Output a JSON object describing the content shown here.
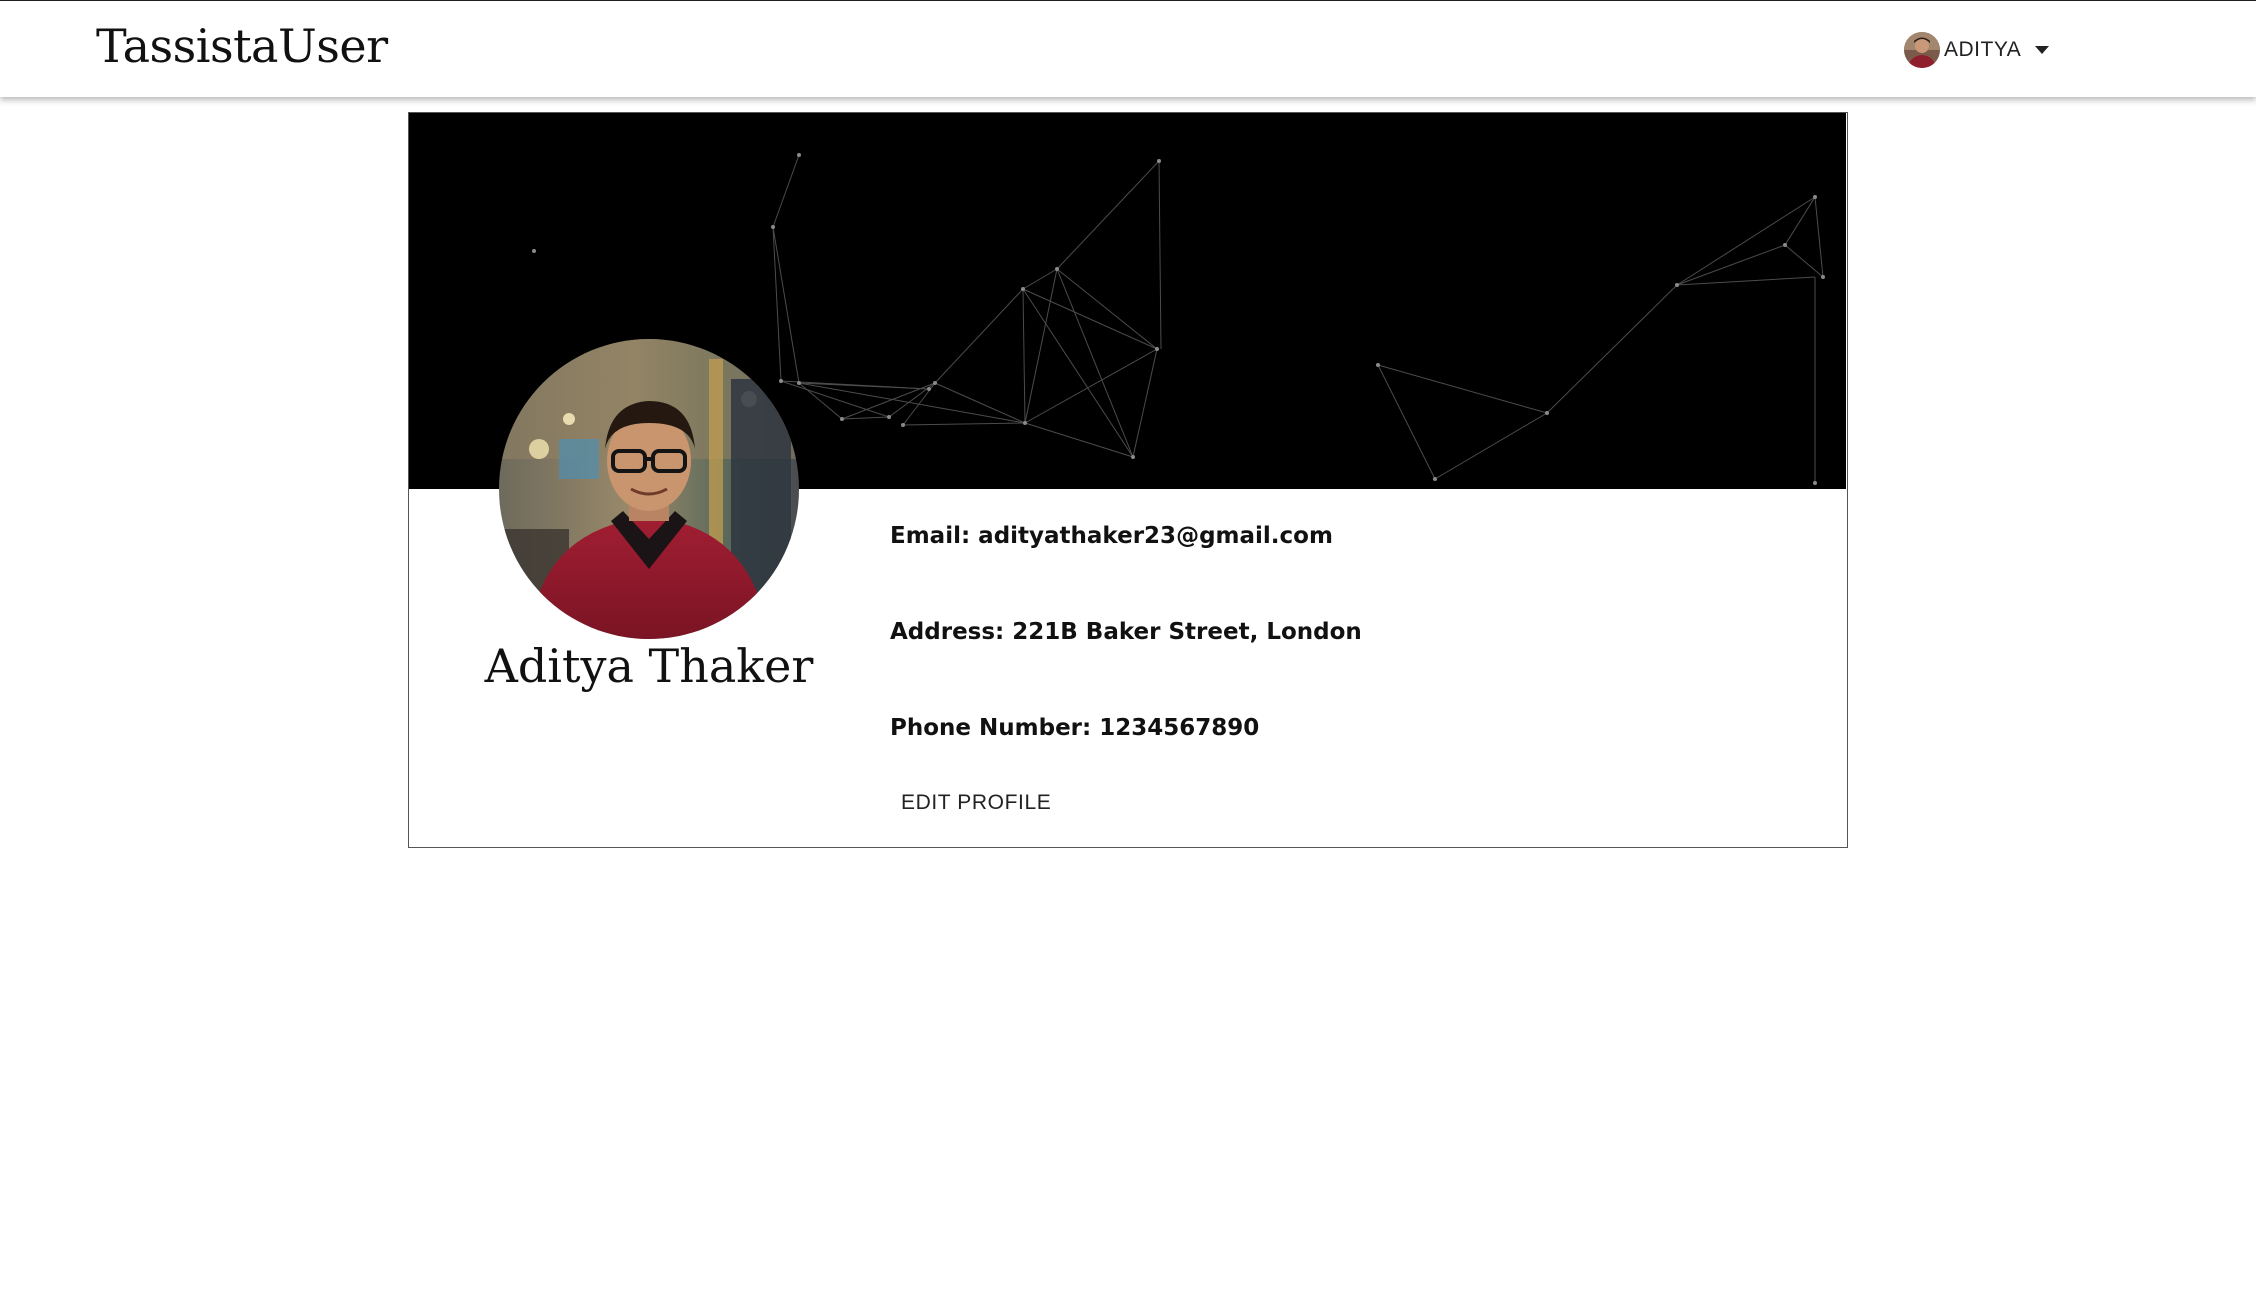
{
  "navbar": {
    "brand": "TassistaUser",
    "user_name": "ADITYA"
  },
  "profile": {
    "name": "Aditya Thaker",
    "email_line": "Email: adityathaker23@gmail.com",
    "address_line": "Address: 221B Baker Street, London",
    "phone_line": "Phone Number: 1234567890",
    "edit_label": "EDIT PROFILE"
  },
  "icons": {
    "user_menu_caret": "caret-down-icon"
  },
  "colors": {
    "cover_bg": "#000000",
    "text": "#111111",
    "network_lines": "#5a5a5a"
  }
}
